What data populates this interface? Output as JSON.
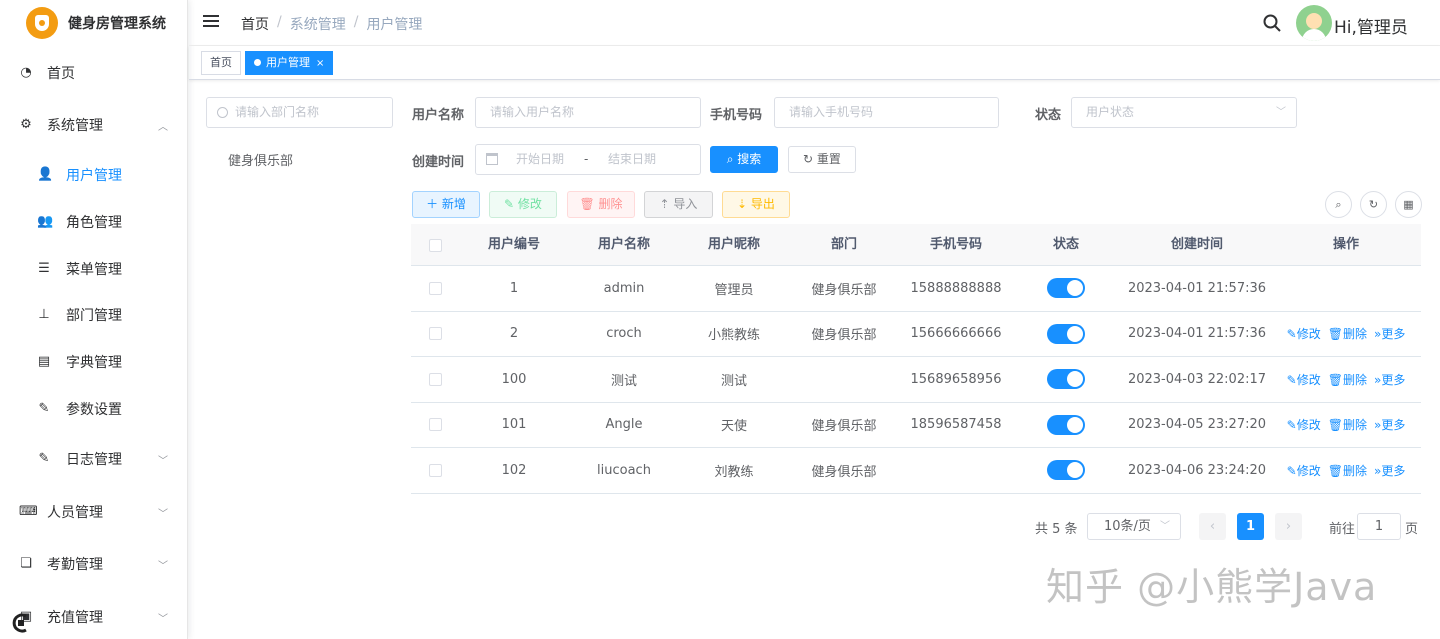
{
  "app": {
    "title": "健身房管理系统",
    "user_greeting": "Hi,管理员"
  },
  "sidebar": {
    "items": [
      {
        "label": "首页",
        "icon": "dashboard-icon"
      },
      {
        "label": "系统管理",
        "icon": "gear-icon",
        "expanded": true
      },
      {
        "label": "用户管理",
        "icon": "user-icon",
        "active": true
      },
      {
        "label": "角色管理",
        "icon": "peoples-icon"
      },
      {
        "label": "菜单管理",
        "icon": "tree-table-icon"
      },
      {
        "label": "部门管理",
        "icon": "tree-icon"
      },
      {
        "label": "字典管理",
        "icon": "dict-icon"
      },
      {
        "label": "参数设置",
        "icon": "edit-icon"
      },
      {
        "label": "日志管理",
        "icon": "log-icon"
      },
      {
        "label": "人员管理",
        "icon": "keyboard-icon"
      },
      {
        "label": "考勤管理",
        "icon": "clipboard-icon"
      },
      {
        "label": "充值管理",
        "icon": "wallet-icon"
      }
    ]
  },
  "breadcrumb": [
    "首页",
    "系统管理",
    "用户管理"
  ],
  "tags": [
    {
      "label": "首页"
    },
    {
      "label": "用户管理",
      "active": true,
      "close": "×"
    }
  ],
  "dept": {
    "search_placeholder": "请输入部门名称",
    "tree": [
      "健身俱乐部"
    ]
  },
  "form": {
    "username_label": "用户名称",
    "username_placeholder": "请输入用户名称",
    "phone_label": "手机号码",
    "phone_placeholder": "请输入手机号码",
    "status_label": "状态",
    "status_placeholder": "用户状态",
    "created_label": "创建时间",
    "start_placeholder": "开始日期",
    "date_sep": "-",
    "end_placeholder": "结束日期",
    "search_btn": "搜索",
    "reset_btn": "重置"
  },
  "toolbar": {
    "add": "新增",
    "edit": "修改",
    "delete": "删除",
    "import": "导入",
    "export": "导出"
  },
  "table": {
    "columns": [
      "用户编号",
      "用户名称",
      "用户昵称",
      "部门",
      "手机号码",
      "状态",
      "创建时间",
      "操作"
    ],
    "rows": [
      {
        "id": "1",
        "username": "admin",
        "nickname": "管理员",
        "dept": "健身俱乐部",
        "phone": "15888888888",
        "status": true,
        "created": "2023-04-01 21:57:36",
        "ops": false
      },
      {
        "id": "2",
        "username": "croch",
        "nickname": "小熊教练",
        "dept": "健身俱乐部",
        "phone": "15666666666",
        "status": true,
        "created": "2023-04-01 21:57:36",
        "ops": true
      },
      {
        "id": "100",
        "username": "测试",
        "nickname": "测试",
        "dept": "",
        "phone": "15689658956",
        "status": true,
        "created": "2023-04-03 22:02:17",
        "ops": true
      },
      {
        "id": "101",
        "username": "Angle",
        "nickname": "天使",
        "dept": "健身俱乐部",
        "phone": "18596587458",
        "status": true,
        "created": "2023-04-05 23:27:20",
        "ops": true
      },
      {
        "id": "102",
        "username": "liucoach",
        "nickname": "刘教练",
        "dept": "健身俱乐部",
        "phone": "",
        "status": true,
        "created": "2023-04-06 23:24:20",
        "ops": true
      }
    ],
    "op_labels": {
      "edit": "修改",
      "delete": "删除",
      "more": "更多"
    }
  },
  "pagination": {
    "total": "共 5 条",
    "page_size": "10条/页",
    "current": "1",
    "goto_prefix": "前往",
    "goto_value": "1",
    "goto_suffix": "页"
  },
  "watermark": "知乎 @小熊学Java",
  "colors": {
    "primary": "#1890ff"
  }
}
